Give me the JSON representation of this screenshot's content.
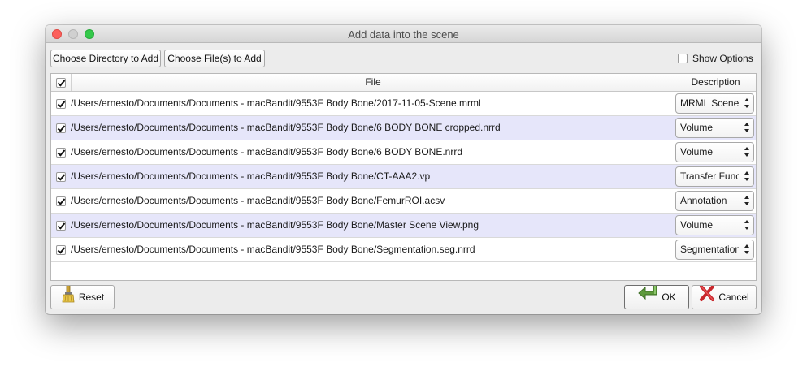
{
  "window": {
    "title": "Add data into the scene"
  },
  "toolbar": {
    "choose_directory_label": "Choose Directory to Add",
    "choose_files_label": "Choose File(s) to Add",
    "show_options_label": "Show Options",
    "show_options_checked": false
  },
  "table": {
    "header_checked": true,
    "columns": {
      "file": "File",
      "description": "Description"
    },
    "rows": [
      {
        "checked": true,
        "file": "/Users/ernesto/Documents/Documents - macBandit/9553F Body Bone/2017-11-05-Scene.mrml",
        "description": "MRML Scene"
      },
      {
        "checked": true,
        "file": "/Users/ernesto/Documents/Documents - macBandit/9553F Body Bone/6 BODY BONE cropped.nrrd",
        "description": "Volume"
      },
      {
        "checked": true,
        "file": "/Users/ernesto/Documents/Documents - macBandit/9553F Body Bone/6 BODY BONE.nrrd",
        "description": "Volume"
      },
      {
        "checked": true,
        "file": "/Users/ernesto/Documents/Documents - macBandit/9553F Body Bone/CT-AAA2.vp",
        "description": "Transfer Function"
      },
      {
        "checked": true,
        "file": "/Users/ernesto/Documents/Documents - macBandit/9553F Body Bone/FemurROI.acsv",
        "description": "Annotation"
      },
      {
        "checked": true,
        "file": "/Users/ernesto/Documents/Documents - macBandit/9553F Body Bone/Master Scene View.png",
        "description": "Volume"
      },
      {
        "checked": true,
        "file": "/Users/ernesto/Documents/Documents - macBandit/9553F Body Bone/Segmentation.seg.nrrd",
        "description": "Segmentation"
      }
    ]
  },
  "footer": {
    "reset_label": "Reset",
    "ok_label": "OK",
    "cancel_label": "Cancel"
  },
  "icons": {
    "reset": "broom-icon",
    "ok": "green-return-arrow-icon",
    "cancel": "red-x-icon"
  },
  "colors": {
    "alt_row": "#e6e6fa",
    "close_light": "#fc605c",
    "zoom_light": "#34c84a"
  }
}
